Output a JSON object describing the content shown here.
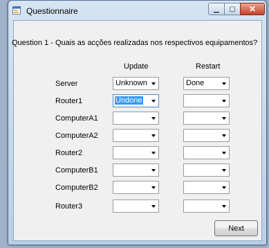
{
  "window": {
    "title": "Questionnaire",
    "minimize_glyph": "▁",
    "maximize_glyph": "▢",
    "close_glyph": "✕",
    "app_icon": "form-icon"
  },
  "form": {
    "question": "Question 1 - Quais as acções realizadas nos respectivos equipamentos?",
    "columns": [
      "Update",
      "Restart"
    ],
    "rows": [
      {
        "label": "Server",
        "update": "Unknown",
        "restart": "Done"
      },
      {
        "label": "Router1",
        "update": "Undone",
        "restart": ""
      },
      {
        "label": "ComputerA1",
        "update": "",
        "restart": ""
      },
      {
        "label": "ComputerA2",
        "update": "",
        "restart": ""
      },
      {
        "label": "Router2",
        "update": "",
        "restart": ""
      },
      {
        "label": "ComputerB1",
        "update": "",
        "restart": ""
      },
      {
        "label": "ComputerB2",
        "update": "",
        "restart": ""
      },
      {
        "label": "Router3",
        "update": "",
        "restart": ""
      }
    ],
    "next_label": "Next"
  },
  "colors": {
    "selection": "#3399ff",
    "title_bar": "#d6e4f2",
    "close_button": "#c3422a"
  }
}
